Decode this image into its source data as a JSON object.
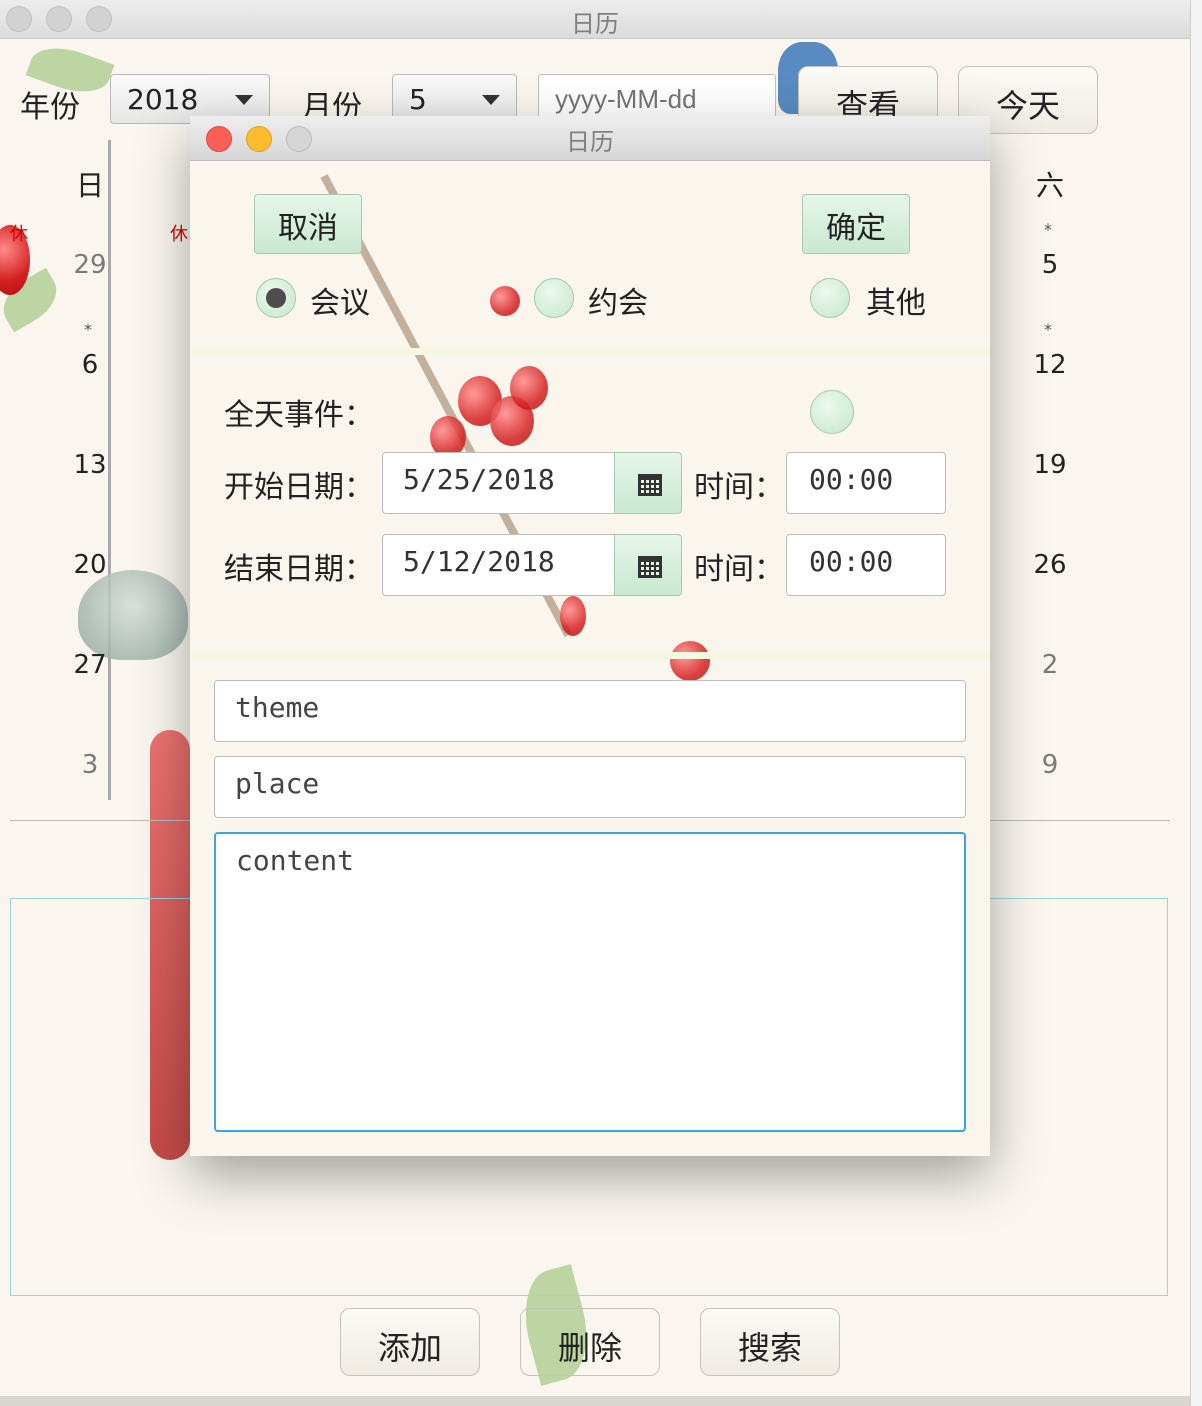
{
  "window": {
    "title": "日历"
  },
  "controls": {
    "year_label": "年份",
    "year_value": "2018",
    "month_label": "月份",
    "month_value": "5",
    "date_placeholder": "yyyy-MM-dd",
    "view_button": "查看",
    "today_button": "今天"
  },
  "calendar": {
    "weekday_first": "日",
    "weekday_last": "六",
    "rest_mark": "休",
    "star_mark": "*",
    "left_column": [
      "29",
      "6",
      "13",
      "20",
      "27",
      "3"
    ],
    "right_column": [
      "5",
      "12",
      "19",
      "26",
      "2",
      "9"
    ]
  },
  "bottom": {
    "add": "添加",
    "delete": "删除",
    "search": "搜索"
  },
  "dialog": {
    "title": "日历",
    "cancel": "取消",
    "confirm": "确定",
    "radios": [
      {
        "label": "会议",
        "selected": true
      },
      {
        "label": "约会",
        "selected": false
      },
      {
        "label": "其他",
        "selected": false
      }
    ],
    "all_day_label": "全天事件：",
    "start_date_label": "开始日期：",
    "start_date_value": "5/25/2018",
    "end_date_label": "结束日期：",
    "end_date_value": "5/12/2018",
    "time_label": "时间：",
    "start_time_value": "00:00",
    "end_time_value": "00:00",
    "theme_placeholder": "theme",
    "place_placeholder": "place",
    "content_placeholder": "content"
  },
  "colors": {
    "accent_green": "#c9e8d1",
    "rest_red": "#d40000",
    "focus_blue": "#3aa6dd"
  }
}
